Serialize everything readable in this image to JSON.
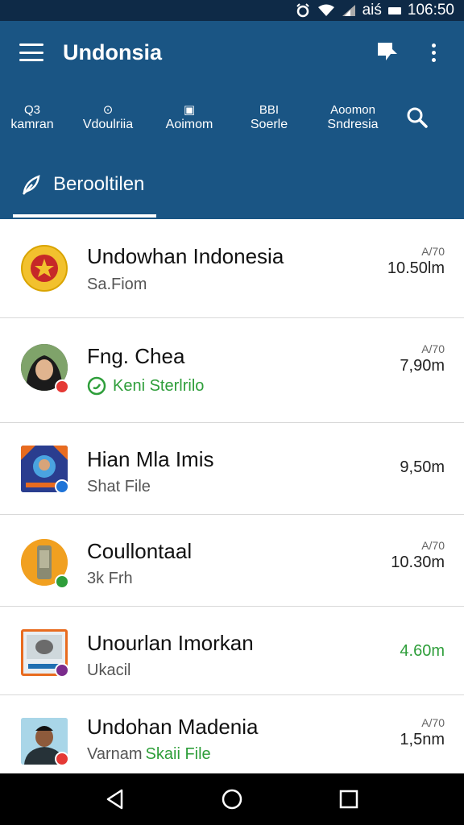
{
  "status_bar": {
    "carrier": "aiś",
    "time": "106:50"
  },
  "app_bar": {
    "title": "Undonsia"
  },
  "categories": [
    {
      "icon": "Q3",
      "label": "kamran"
    },
    {
      "icon": "⊙",
      "label": "Vdoulriia"
    },
    {
      "icon": "▣",
      "label": "Aoimom"
    },
    {
      "icon": "BBI",
      "label": "Soerle"
    },
    {
      "icon": "Aoomon",
      "label": "Sndresia"
    }
  ],
  "tab": {
    "label": "Berooltilen"
  },
  "chats": [
    {
      "title": "Undowhan Indonesia",
      "subtitle": "Sa.Fiom",
      "meta": "A/70",
      "time": "10.50lm",
      "badge_color": ""
    },
    {
      "title": "Fng. Chea",
      "subtitle": "Keni Sterlrilo",
      "meta": "A/70",
      "time": "7,90m",
      "badge_color": "#e53935"
    },
    {
      "title": "Hian Mla Imis",
      "subtitle": "Shat File",
      "meta": "",
      "time": "9,50m",
      "badge_color": "#1e73d8"
    },
    {
      "title": "Coullontaal",
      "subtitle": "3k Frh",
      "meta": "A/70",
      "time": "10.30m",
      "badge_color": "#2e9e3a"
    },
    {
      "title": "Unourlan Imorkan",
      "subtitle": "Ukacil",
      "meta": "",
      "time": "4.60m",
      "badge_color": "#7b2b8c"
    },
    {
      "title": "Undohan Madenia",
      "subtitle_a": "Varnam",
      "subtitle_b": "Skaii File",
      "meta": "A/70",
      "time": "1,5nm",
      "badge_color": "#e53935"
    }
  ]
}
